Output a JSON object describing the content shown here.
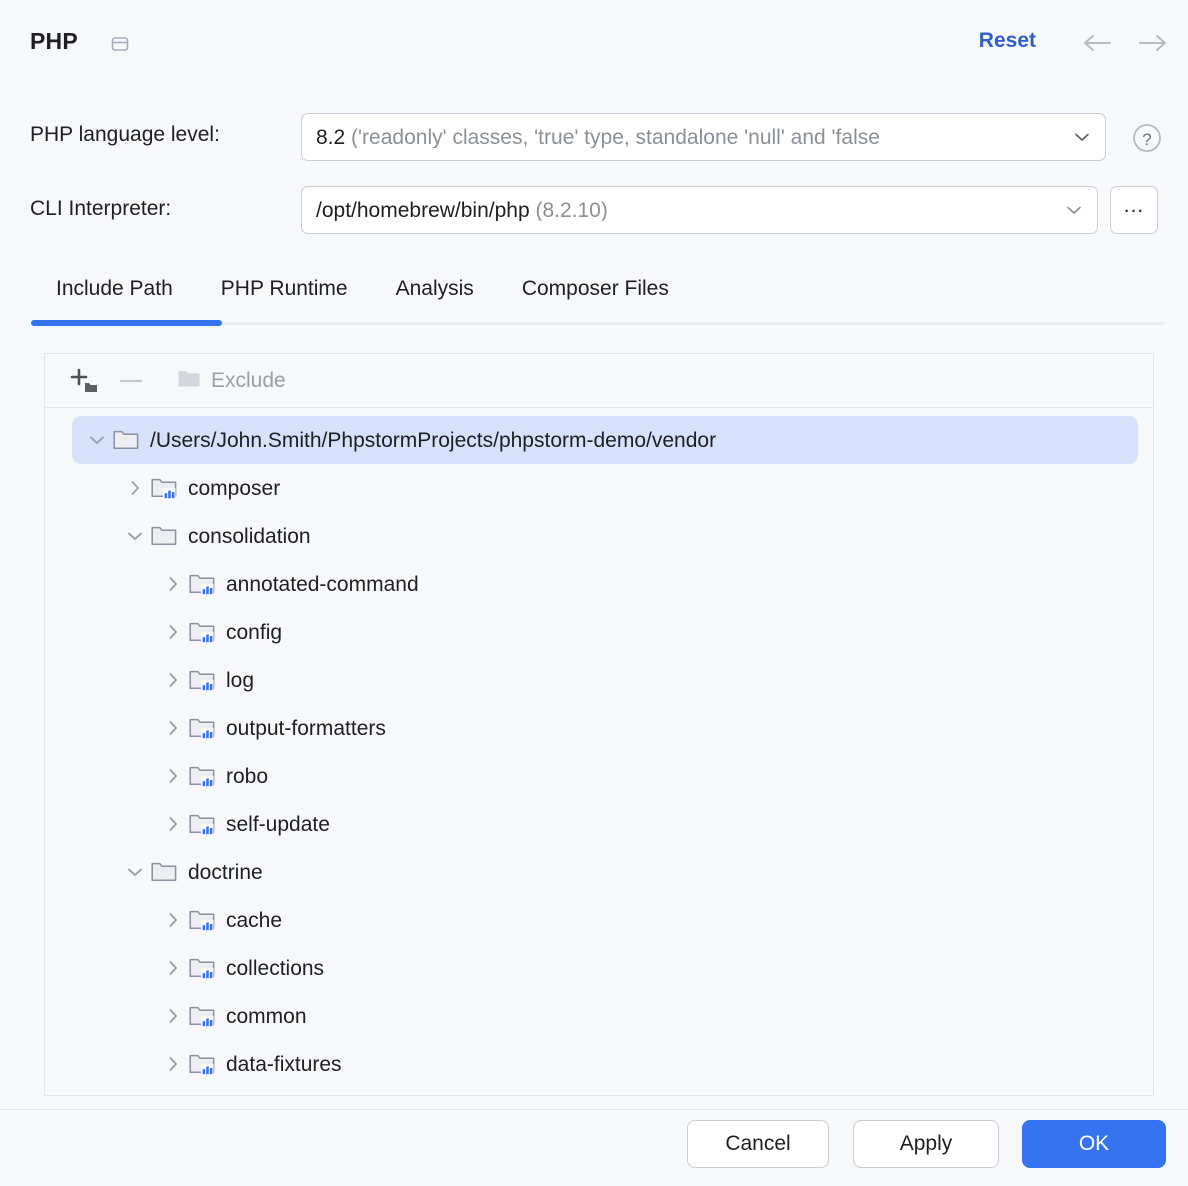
{
  "header": {
    "title": "PHP",
    "window_icon": "window-panel-icon",
    "reset_label": "Reset",
    "back_icon": "arrow-left-icon",
    "forward_icon": "arrow-right-icon"
  },
  "form": {
    "language_level": {
      "label": "PHP language level:",
      "value_primary": "8.2",
      "value_muted": "('readonly' classes, 'true' type, standalone 'null' and 'false",
      "chevron_icon": "chevron-down-icon",
      "help_icon": "question-mark-icon"
    },
    "cli_interpreter": {
      "label": "CLI Interpreter:",
      "value_primary": "/opt/homebrew/bin/php",
      "value_muted": "(8.2.10)",
      "chevron_icon": "chevron-down-icon",
      "browse_label": "...",
      "browse_icon": "ellipsis-icon"
    }
  },
  "tabs": {
    "items": [
      {
        "label": "Include Path",
        "active": true
      },
      {
        "label": "PHP Runtime",
        "active": false
      },
      {
        "label": "Analysis",
        "active": false
      },
      {
        "label": "Composer Files",
        "active": false
      }
    ]
  },
  "tree_toolbar": {
    "add_label": "Add",
    "add_icon": "add-folder-icon",
    "remove_label": "Remove",
    "remove_icon": "minus-icon",
    "exclude_label": "Exclude",
    "exclude_icon": "folder-icon"
  },
  "tree": {
    "rows": [
      {
        "label": "/Users/John.Smith/PhpstormProjects/phpstorm-demo/vendor",
        "depth": 0,
        "state": "expanded",
        "icon": "folder-icon",
        "selected": true
      },
      {
        "label": "composer",
        "depth": 1,
        "state": "collapsed",
        "icon": "folder-library-icon",
        "selected": false
      },
      {
        "label": "consolidation",
        "depth": 1,
        "state": "expanded",
        "icon": "folder-icon",
        "selected": false
      },
      {
        "label": "annotated-command",
        "depth": 2,
        "state": "collapsed",
        "icon": "folder-library-icon",
        "selected": false
      },
      {
        "label": "config",
        "depth": 2,
        "state": "collapsed",
        "icon": "folder-library-icon",
        "selected": false
      },
      {
        "label": "log",
        "depth": 2,
        "state": "collapsed",
        "icon": "folder-library-icon",
        "selected": false
      },
      {
        "label": "output-formatters",
        "depth": 2,
        "state": "collapsed",
        "icon": "folder-library-icon",
        "selected": false
      },
      {
        "label": "robo",
        "depth": 2,
        "state": "collapsed",
        "icon": "folder-library-icon",
        "selected": false
      },
      {
        "label": "self-update",
        "depth": 2,
        "state": "collapsed",
        "icon": "folder-library-icon",
        "selected": false
      },
      {
        "label": "doctrine",
        "depth": 1,
        "state": "expanded",
        "icon": "folder-icon",
        "selected": false
      },
      {
        "label": "cache",
        "depth": 2,
        "state": "collapsed",
        "icon": "folder-library-icon",
        "selected": false
      },
      {
        "label": "collections",
        "depth": 2,
        "state": "collapsed",
        "icon": "folder-library-icon",
        "selected": false
      },
      {
        "label": "common",
        "depth": 2,
        "state": "collapsed",
        "icon": "folder-library-icon",
        "selected": false
      },
      {
        "label": "data-fixtures",
        "depth": 2,
        "state": "collapsed",
        "icon": "folder-library-icon",
        "selected": false
      }
    ]
  },
  "footer": {
    "cancel_label": "Cancel",
    "apply_label": "Apply",
    "ok_label": "OK"
  },
  "colors": {
    "accent": "#3574f0",
    "link": "#2f5fc4",
    "selection": "#d6e2fb",
    "background": "#f7f8fa",
    "muted_text": "#8a8f98"
  }
}
